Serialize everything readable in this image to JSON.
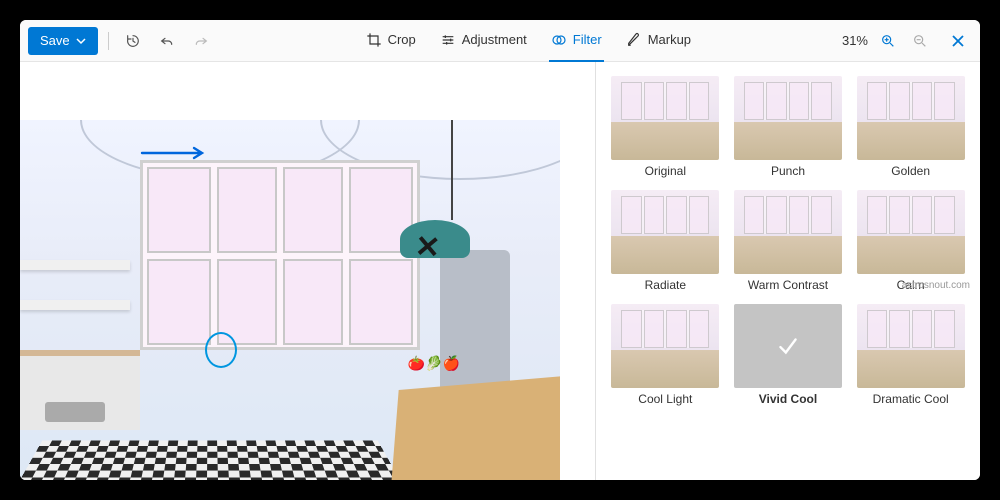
{
  "toolbar": {
    "save_label": "Save",
    "tabs": {
      "crop": "Crop",
      "adjustment": "Adjustment",
      "filter": "Filter",
      "markup": "Markup"
    },
    "zoom": "31%"
  },
  "filters": [
    {
      "label": "Original"
    },
    {
      "label": "Punch"
    },
    {
      "label": "Golden"
    },
    {
      "label": "Radiate"
    },
    {
      "label": "Warm Contrast"
    },
    {
      "label": "Calm"
    },
    {
      "label": "Cool Light"
    },
    {
      "label": "Vivid Cool",
      "selected": true
    },
    {
      "label": "Dramatic Cool"
    }
  ],
  "watermark": "astrosnout.com",
  "colors": {
    "accent": "#0078d4"
  }
}
